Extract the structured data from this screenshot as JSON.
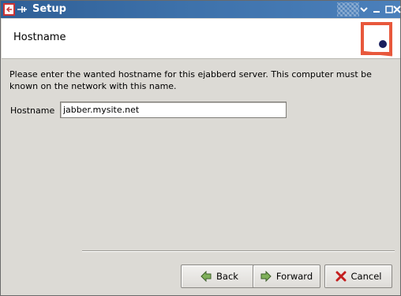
{
  "window": {
    "title": "Setup"
  },
  "header": {
    "title": "Hostname"
  },
  "main": {
    "intro": "Please enter the wanted hostname for this ejabberd server. This computer must be known on the network with this name.",
    "hostname_label": "Hostname",
    "hostname_value": "jabber.mysite.net"
  },
  "buttons": {
    "back": "Back",
    "forward": "Forward",
    "cancel": "Cancel"
  },
  "colors": {
    "titlebar": "#3d71aa",
    "logo_frame": "#e8583c",
    "logo_dot": "#1a1f5e"
  },
  "icons": [
    "setup-app-icon",
    "shade-icon",
    "minimize-icon",
    "maximize-icon",
    "close-icon",
    "back-arrow-icon",
    "forward-arrow-icon",
    "cancel-x-icon"
  ]
}
